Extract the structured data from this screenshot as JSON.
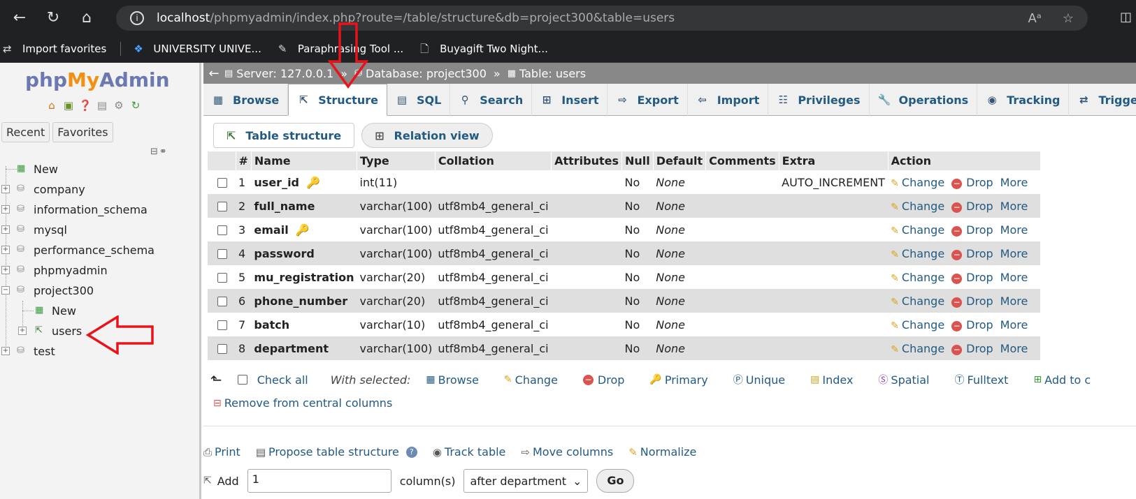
{
  "browser": {
    "url_host": "localhost",
    "url_rest": "/phpmyadmin/index.php?route=/table/structure&db=project300&table=users",
    "favorites": [
      {
        "label": "Import favorites"
      },
      {
        "label": "UNIVERSITY UNIVE..."
      },
      {
        "label": "Paraphrasing Tool ..."
      },
      {
        "label": "Buyagift Two Night..."
      }
    ]
  },
  "sidebar": {
    "logo_php": "php",
    "logo_my": "My",
    "logo_admin": "Admin",
    "recent_label": "Recent",
    "favorites_label": "Favorites",
    "tree": [
      {
        "label": "New"
      },
      {
        "label": "company"
      },
      {
        "label": "information_schema"
      },
      {
        "label": "mysql"
      },
      {
        "label": "performance_schema"
      },
      {
        "label": "phpmyadmin"
      },
      {
        "label": "project300"
      },
      {
        "label": "New"
      },
      {
        "label": "users"
      },
      {
        "label": "test"
      }
    ]
  },
  "breadcrumb": {
    "server": "Server: 127.0.0.1",
    "database": "Database: project300",
    "table": "Table: users",
    "separator": "»"
  },
  "tabs": [
    {
      "label": "Browse",
      "icon": "browse-icon"
    },
    {
      "label": "Structure",
      "icon": "structure-icon",
      "active": true
    },
    {
      "label": "SQL",
      "icon": "sql-icon"
    },
    {
      "label": "Search",
      "icon": "search-icon"
    },
    {
      "label": "Insert",
      "icon": "insert-icon"
    },
    {
      "label": "Export",
      "icon": "export-icon"
    },
    {
      "label": "Import",
      "icon": "import-icon"
    },
    {
      "label": "Privileges",
      "icon": "privileges-icon"
    },
    {
      "label": "Operations",
      "icon": "operations-icon"
    },
    {
      "label": "Tracking",
      "icon": "tracking-icon"
    },
    {
      "label": "Triggers",
      "icon": "triggers-icon"
    }
  ],
  "subtabs": {
    "table_structure": "Table structure",
    "relation_view": "Relation view"
  },
  "table": {
    "headers": [
      "#",
      "Name",
      "Type",
      "Collation",
      "Attributes",
      "Null",
      "Default",
      "Comments",
      "Extra",
      "Action"
    ],
    "rows": [
      {
        "num": "1",
        "name": "user_id",
        "type": "int(11)",
        "collation": "",
        "null": "No",
        "default": "None",
        "extra": "AUTO_INCREMENT",
        "key": "primary"
      },
      {
        "num": "2",
        "name": "full_name",
        "type": "varchar(100)",
        "collation": "utf8mb4_general_ci",
        "null": "No",
        "default": "None",
        "extra": ""
      },
      {
        "num": "3",
        "name": "email",
        "type": "varchar(100)",
        "collation": "utf8mb4_general_ci",
        "null": "No",
        "default": "None",
        "extra": "",
        "key": "unique"
      },
      {
        "num": "4",
        "name": "password",
        "type": "varchar(100)",
        "collation": "utf8mb4_general_ci",
        "null": "No",
        "default": "None",
        "extra": ""
      },
      {
        "num": "5",
        "name": "mu_registration",
        "type": "varchar(20)",
        "collation": "utf8mb4_general_ci",
        "null": "No",
        "default": "None",
        "extra": ""
      },
      {
        "num": "6",
        "name": "phone_number",
        "type": "varchar(20)",
        "collation": "utf8mb4_general_ci",
        "null": "No",
        "default": "None",
        "extra": ""
      },
      {
        "num": "7",
        "name": "batch",
        "type": "varchar(10)",
        "collation": "utf8mb4_general_ci",
        "null": "No",
        "default": "None",
        "extra": ""
      },
      {
        "num": "8",
        "name": "department",
        "type": "varchar(100)",
        "collation": "utf8mb4_general_ci",
        "null": "No",
        "default": "None",
        "extra": ""
      }
    ],
    "action_change": "Change",
    "action_drop": "Drop",
    "action_more": "More"
  },
  "with_selected": {
    "check_all": "Check all",
    "label": "With selected:",
    "items": [
      "Browse",
      "Change",
      "Drop",
      "Primary",
      "Unique",
      "Index",
      "Spatial",
      "Fulltext",
      "Add to c"
    ],
    "remove_central": "Remove from central columns"
  },
  "bottom": {
    "print": "Print",
    "propose": "Propose table structure",
    "track": "Track table",
    "move": "Move columns",
    "normalize": "Normalize",
    "add_label": "Add",
    "add_value": "1",
    "columns_label": "column(s)",
    "position_value": "after department",
    "go_label": "Go"
  },
  "colors": {
    "link": "#235a81",
    "annotation_arrow": "#e8141b",
    "logo_blue": "#6c78af",
    "logo_orange": "#f29111"
  }
}
